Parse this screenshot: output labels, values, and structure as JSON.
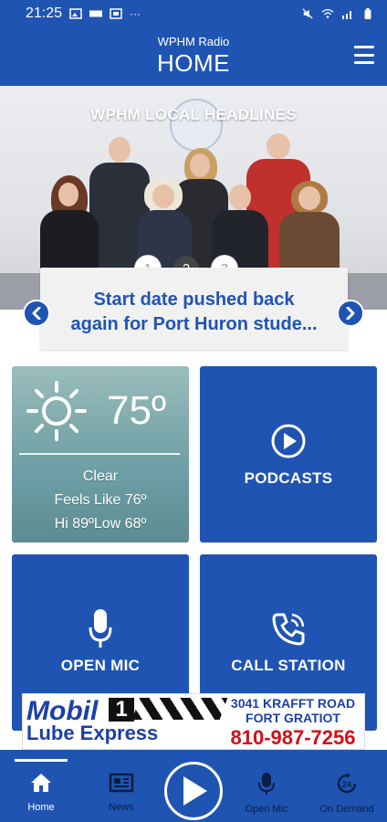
{
  "status_bar": {
    "time": "21:25",
    "extra": "···"
  },
  "header": {
    "subtitle": "WPHM Radio",
    "title": "HOME"
  },
  "hero": {
    "heading": "WPHM LOCAL HEADLINES",
    "dots": [
      "1",
      "2",
      "3"
    ],
    "active_dot": 2,
    "headline": "Start date pushed back\nagain for Port Huron stude..."
  },
  "tiles": {
    "weather": {
      "temp": "75º",
      "condition": "Clear",
      "feels_like": "Feels Like 76º",
      "hi_low": "Hi 89ºLow 68º"
    },
    "podcasts": {
      "label": "PODCASTS"
    },
    "open_mic": {
      "label": "OPEN MIC"
    },
    "call_station": {
      "label": "CALL STATION"
    }
  },
  "ad": {
    "brand": "Mobil",
    "one": "1",
    "sub": "Lube Express",
    "address": "3041 KRAFFT ROAD\nFORT GRATIOT",
    "phone": "810-987-7256"
  },
  "bottom_nav": {
    "items": [
      {
        "label": "Home",
        "icon": "home-icon"
      },
      {
        "label": "News",
        "icon": "newspaper-icon"
      },
      {
        "label": "Open Mic",
        "icon": "microphone-icon"
      },
      {
        "label": "On Demand",
        "icon": "on-demand-24-icon"
      }
    ]
  },
  "colors": {
    "primary": "#1f54b2",
    "headline_card": "#f1f1f1",
    "ad_phone": "#d10f1a"
  }
}
